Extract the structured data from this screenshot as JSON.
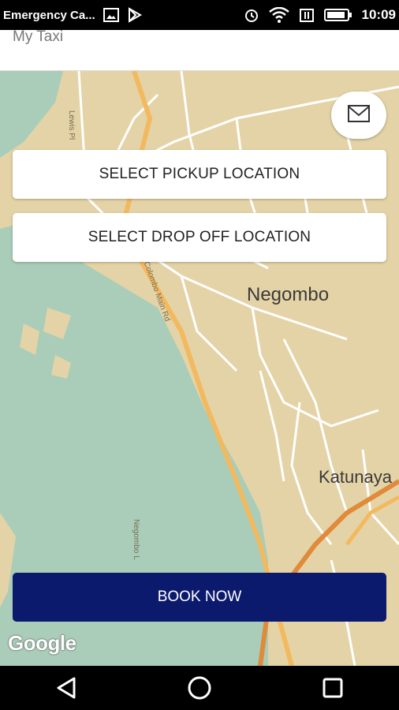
{
  "status_bar": {
    "notification_text": "Emergency Ca...",
    "time": "10:09",
    "icons": [
      "image-icon",
      "play-store-icon",
      "alarm-icon",
      "wifi-icon",
      "data-icon",
      "battery-icon"
    ]
  },
  "app_bar": {
    "title": "My Taxi"
  },
  "map": {
    "labels": {
      "city1": "Negombo",
      "city2": "Katunaya",
      "road1": "Lewis Pl",
      "road2": "Colombo Main Rd",
      "road3": "Negombo L"
    },
    "attribution": "Google"
  },
  "buttons": {
    "pickup": "SELECT PICKUP LOCATION",
    "dropoff": "SELECT DROP OFF LOCATION",
    "book": "BOOK NOW"
  },
  "colors": {
    "primary": "#0c1a6e",
    "map_land": "#e4d3a6",
    "map_water": "#a9cdb9",
    "road_major": "#f3b95f"
  }
}
